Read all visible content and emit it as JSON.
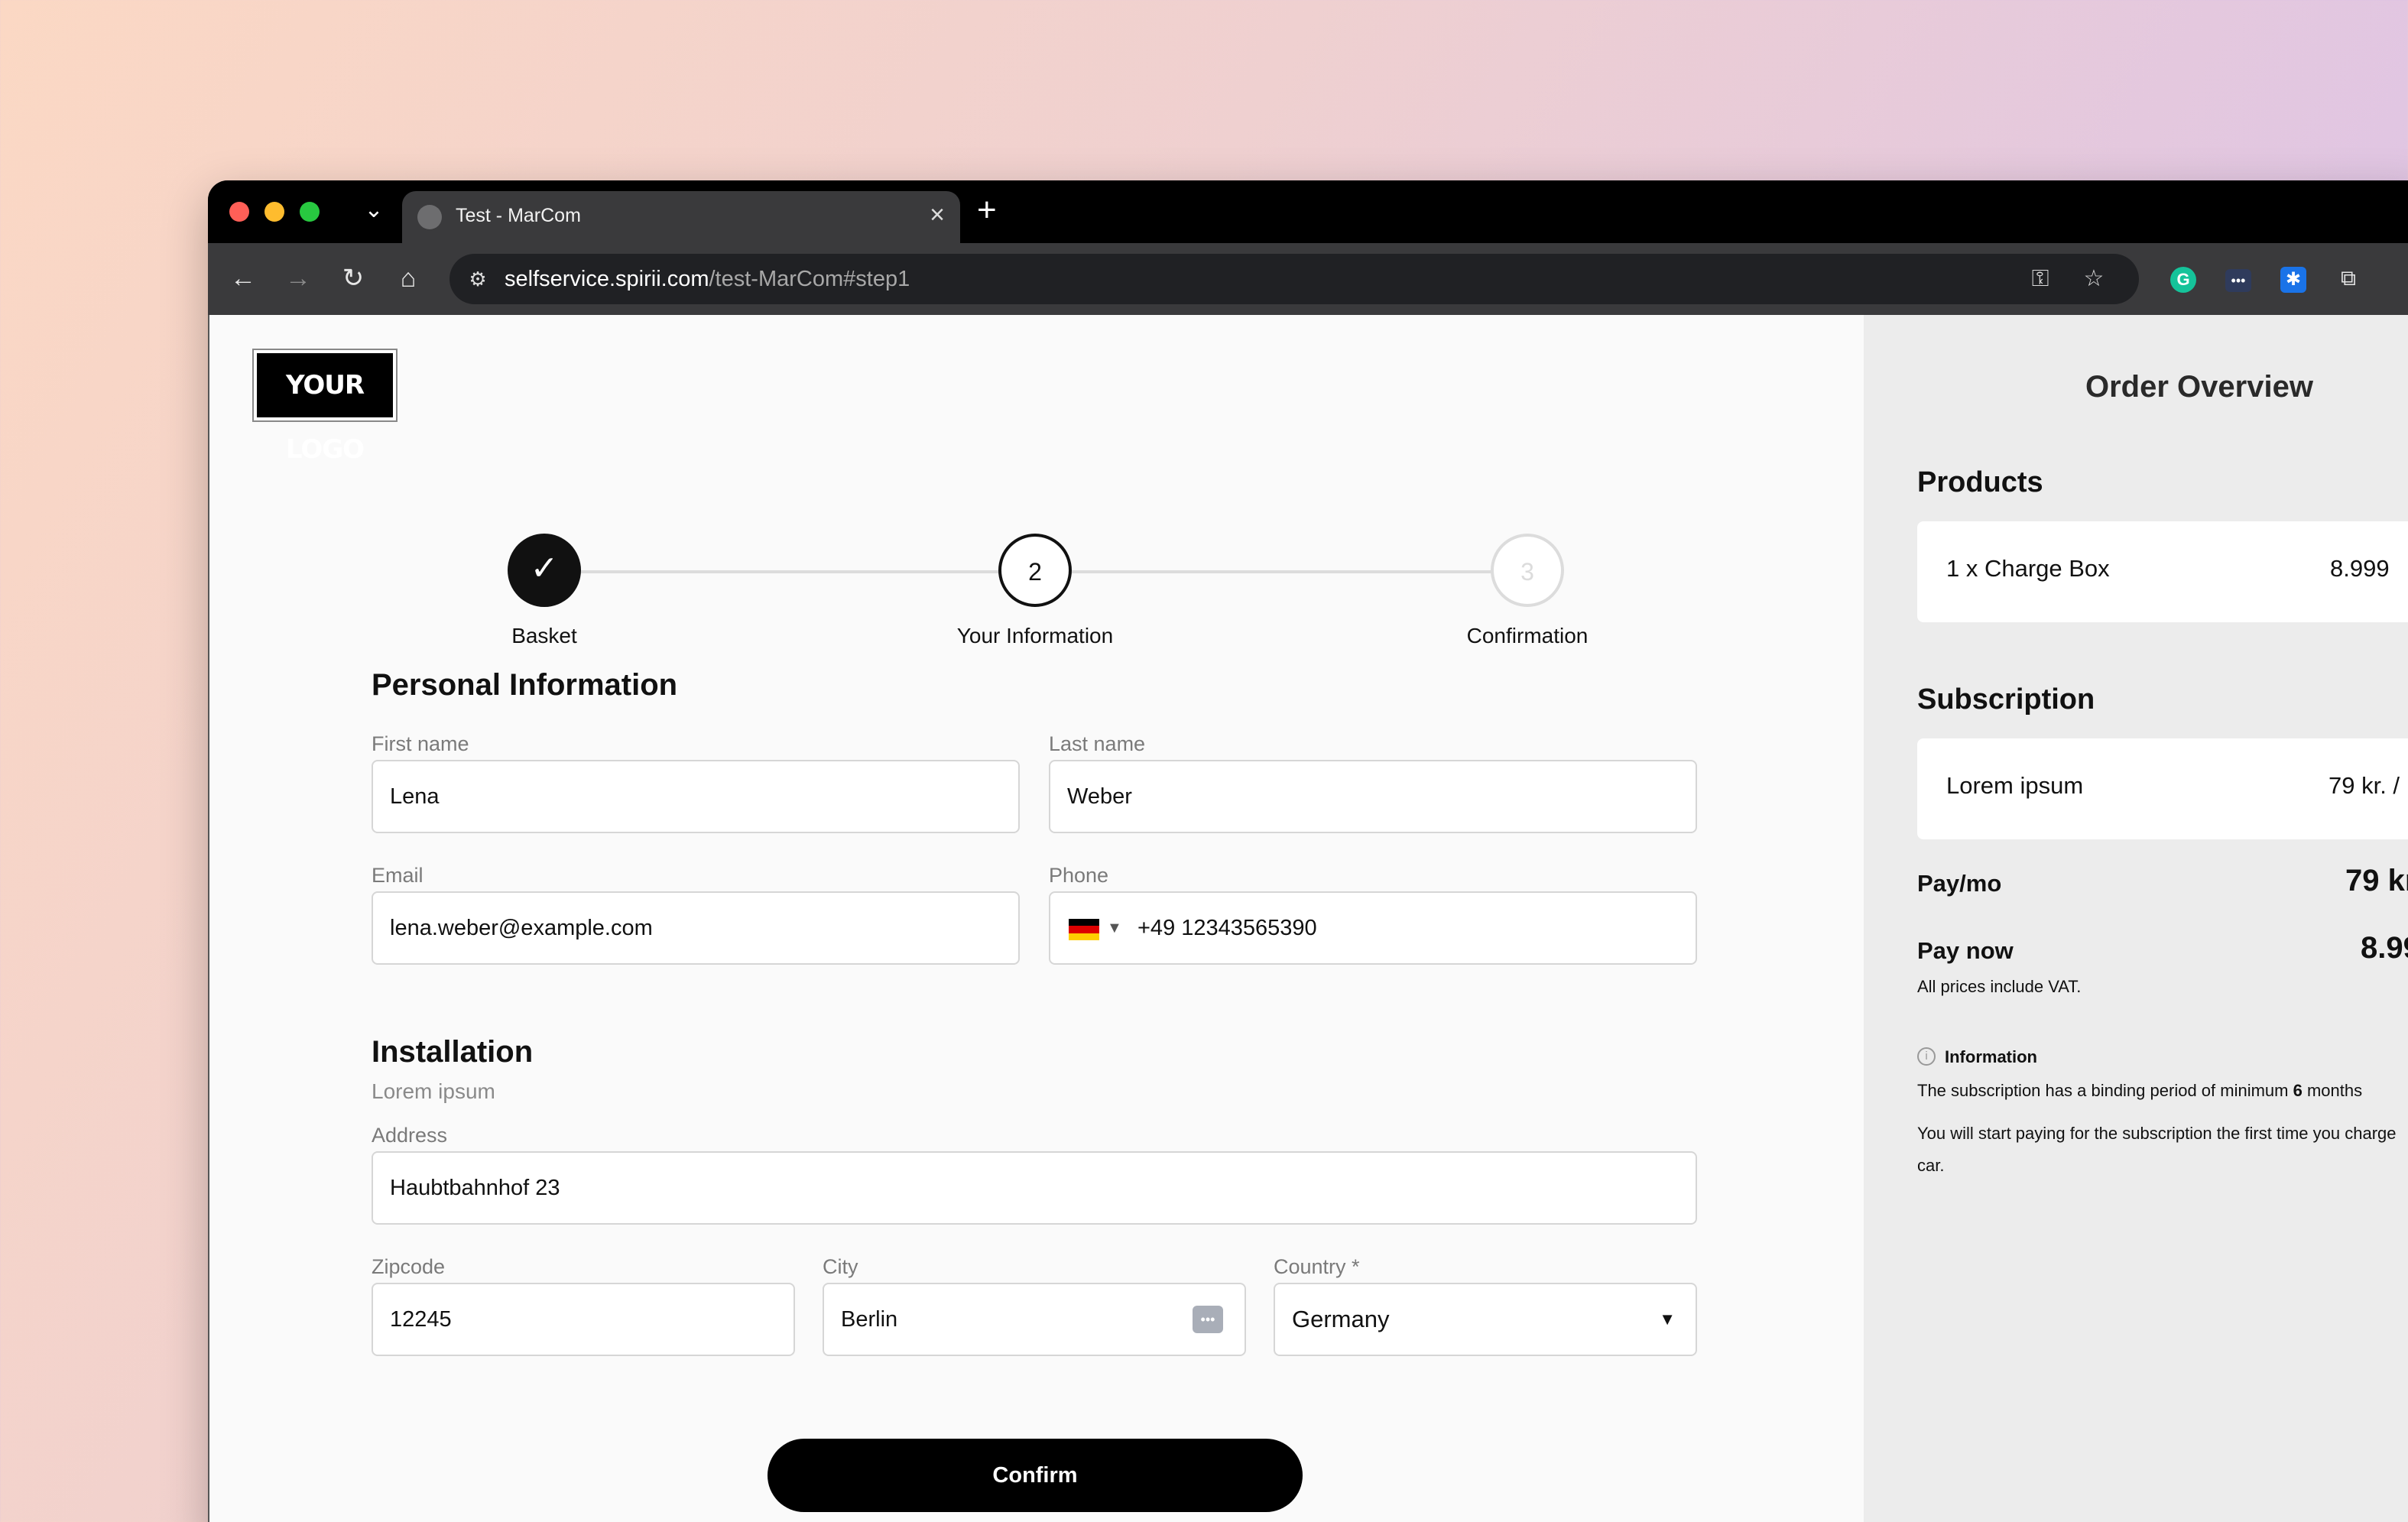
{
  "browser": {
    "tab_title": "Test - MarCom",
    "url_host": "selfservice.spirii.com",
    "url_path": "/test-MarCom#step1"
  },
  "logo_text": "YOUR LOGO",
  "stepper": {
    "steps": [
      {
        "number": "",
        "label": "Basket",
        "state": "done"
      },
      {
        "number": "2",
        "label": "Your Information",
        "state": "active"
      },
      {
        "number": "3",
        "label": "Confirmation",
        "state": "pending"
      }
    ]
  },
  "personal": {
    "title": "Personal Information",
    "first_name_label": "First name",
    "first_name_value": "Lena",
    "last_name_label": "Last name",
    "last_name_value": "Weber",
    "email_label": "Email",
    "email_value": "lena.weber@example.com",
    "phone_label": "Phone",
    "phone_value": "+49 12343565390"
  },
  "installation": {
    "title": "Installation",
    "subtitle": "Lorem ipsum",
    "address_label": "Address",
    "address_value": "Haubtbahnhof 23",
    "zipcode_label": "Zipcode",
    "zipcode_value": "12245",
    "city_label": "City",
    "city_value": "Berlin",
    "country_label": "Country *",
    "country_value": "Germany"
  },
  "confirm_label": "Confirm",
  "order": {
    "title": "Order Overview",
    "products_heading": "Products",
    "product_name": "1 x Charge Box",
    "product_price": "8.999",
    "subscription_heading": "Subscription",
    "subscription_name": "Lorem ipsum",
    "subscription_price": "79 kr. /",
    "pay_mo_label": "Pay/mo",
    "pay_mo_value": "79 kr.",
    "pay_now_label": "Pay now",
    "pay_now_value": "8.99",
    "vat_note": "All prices include VAT.",
    "info_heading": "Information",
    "info_line1_pre": "The subscription has a binding period of minimum ",
    "info_line1_bold": "6",
    "info_line1_post": " months",
    "info_line2": "You will start paying for the subscription the first time you charge",
    "info_line3": "car."
  },
  "colors": {
    "accent": "#000000",
    "step_done": "#111111",
    "step_pending": "#dcdcdc"
  }
}
